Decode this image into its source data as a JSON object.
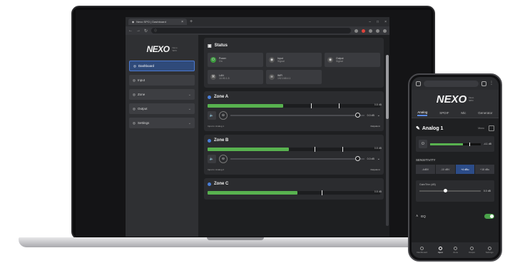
{
  "browser": {
    "tab_title": "Nexo SPO | Dashboard",
    "tab_close": "×",
    "new_tab": "+",
    "win_min": "–",
    "win_max": "□",
    "win_close": "×",
    "nav_back": "←",
    "nav_forward": "→",
    "nav_reload": "↻",
    "url_icon": "ⓘ"
  },
  "app": {
    "logo": "NEXO",
    "logo_sub": "Nexo\nSPO",
    "sidebar": [
      {
        "label": "Dashboard",
        "icon": "dashboard-icon",
        "glyph": "◎"
      },
      {
        "label": "Input",
        "icon": "input-icon",
        "glyph": "◎"
      },
      {
        "label": "Zone",
        "icon": "zone-icon",
        "glyph": "◎",
        "chevron": "⌄"
      },
      {
        "label": "Output",
        "icon": "output-icon",
        "glyph": "◎",
        "chevron": "⌄"
      },
      {
        "label": "Settings",
        "icon": "settings-icon",
        "glyph": "◎",
        "chevron": "⌄"
      }
    ],
    "status": {
      "title": "Status",
      "tiles": [
        {
          "label": "Power",
          "value": "On",
          "icon": "power-icon",
          "glyph": "⏻"
        },
        {
          "label": "Input",
          "value": "Signal",
          "icon": "input-signal-icon",
          "glyph": "◉"
        },
        {
          "label": "Output",
          "value": "Signal",
          "icon": "output-signal-icon",
          "glyph": "◉"
        },
        {
          "label": "LAN",
          "value": "10.90.1.5",
          "icon": "lan-icon",
          "glyph": "⌘"
        },
        {
          "label": "WiFi",
          "value": "192.168.4.1",
          "icon": "wifi-icon",
          "glyph": "≋"
        }
      ]
    },
    "zones": [
      {
        "name": "Zone A",
        "meter_value": "0.8 dB",
        "volume": "0.0 dB",
        "input_label": "Input is: Analog 1",
        "output_link": "Outputs in"
      },
      {
        "name": "Zone B",
        "meter_value": "0.8 dB",
        "volume": "0.0 dB",
        "input_label": "Input is: Analog 2",
        "output_link": "Outputs in"
      },
      {
        "name": "Zone C",
        "meter_value": "0.8 dB"
      }
    ],
    "volume_icon": "🔈",
    "mute_icon": "⊖",
    "dropdown_icon": "⌄"
  },
  "phone": {
    "logo": "NEXO",
    "logo_sub": "Nexo\nSPO",
    "tabs": [
      "Analog",
      "SPDIF",
      "Mic",
      "Generator"
    ],
    "active_tab": 0,
    "channel_title": "Analog 1",
    "channel_tag": "Mono",
    "level_value": "-4.1 dB",
    "sensitivity_label": "SENSITIVITY",
    "sensitivity_options": [
      "-4dBV",
      "-10 dBV",
      "+4 dBu",
      "+18 dBu"
    ],
    "sensitivity_selected": 2,
    "gain_label": "Gain/Trim (dB)",
    "gain_value": "0.0 dB",
    "eq_label": "EQ",
    "eq_on": true,
    "bottom_nav": [
      "Dashboard",
      "Input",
      "Zone",
      "Output",
      "Settings"
    ],
    "bottom_active": 1
  },
  "colors": {
    "accent_blue": "#4c7ad0",
    "meter_green": "#58b24f",
    "peak_marker": "#e6e6e6",
    "recording_red": "#e0433b"
  }
}
